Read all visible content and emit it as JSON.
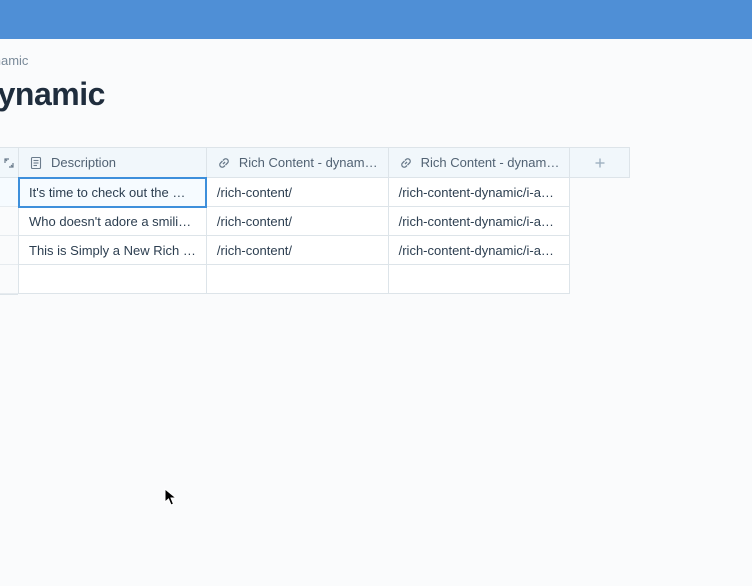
{
  "breadcrumb": "dynamic",
  "page_title": "- dynamic",
  "columns": {
    "description": {
      "label": "Description",
      "icon": "description-icon"
    },
    "link1": {
      "label": "Rich Content - dynam…",
      "icon": "link-icon"
    },
    "link2": {
      "label": "Rich Content - dynam…",
      "icon": "link-icon"
    }
  },
  "rows": [
    {
      "description": "It's time to check out the …",
      "link1": "/rich-content/",
      "link2": "/rich-content-dynamic/i-a…",
      "selected": true
    },
    {
      "description": "Who doesn't adore a smili…",
      "link1": "/rich-content/",
      "link2": "/rich-content-dynamic/i-a…",
      "selected": false
    },
    {
      "description": "This is Simply a New Rich …",
      "link1": "/rich-content/",
      "link2": "/rich-content-dynamic/i-a…",
      "selected": false
    }
  ]
}
